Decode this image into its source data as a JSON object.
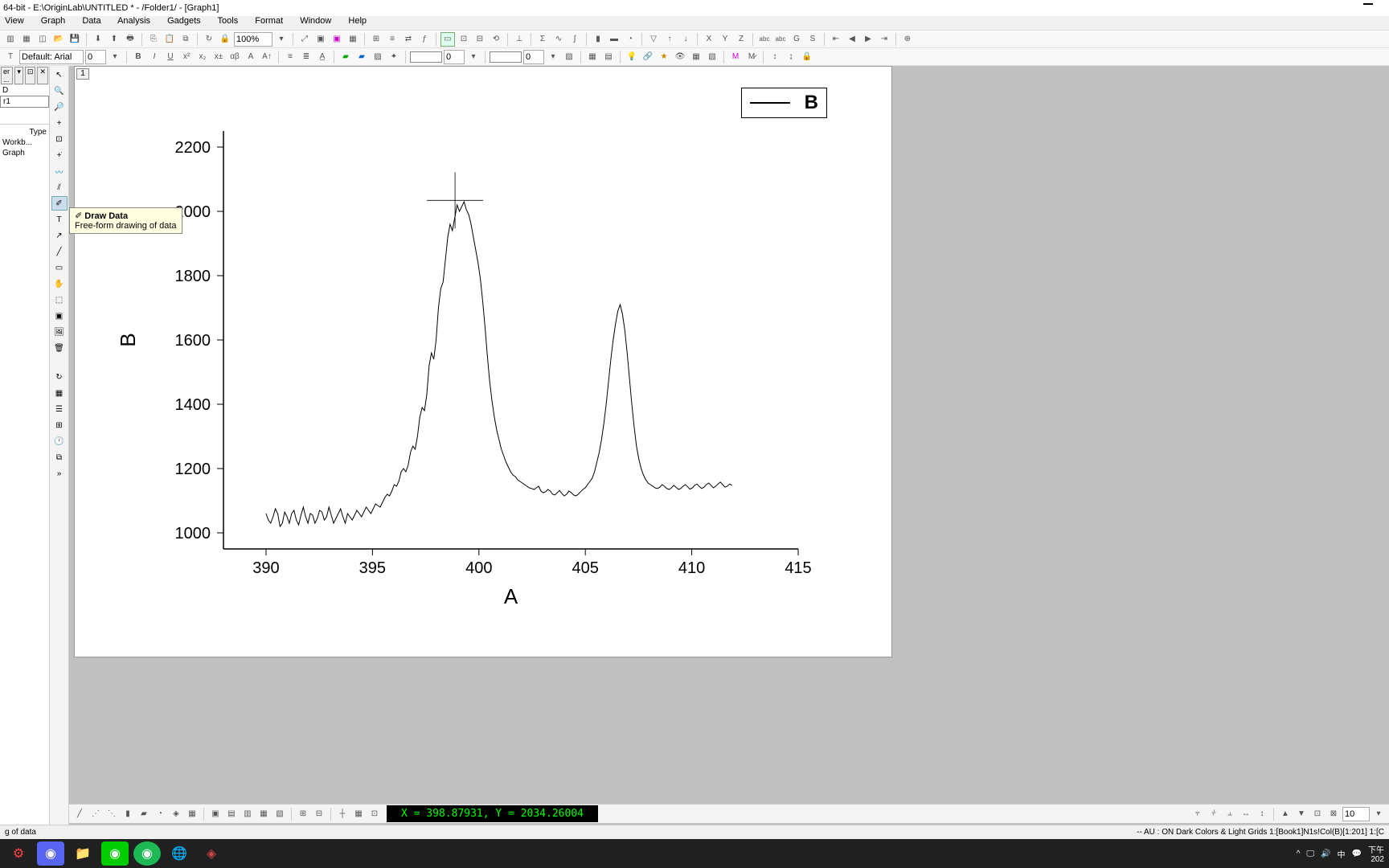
{
  "window": {
    "title": "64-bit - E:\\OriginLab\\UNTITLED * - /Folder1/ - [Graph1]"
  },
  "menu": {
    "items": [
      "View",
      "Graph",
      "Data",
      "Analysis",
      "Gadgets",
      "Tools",
      "Format",
      "Window",
      "Help"
    ]
  },
  "toolbar1": {
    "zoom": "100%"
  },
  "toolbar2": {
    "font_label": "Default: Arial",
    "font_size": "0",
    "num1": "0",
    "num2": "0"
  },
  "project": {
    "col_type": "Type",
    "rows": [
      "D",
      "r1",
      "Workb...",
      "Graph"
    ]
  },
  "tooltip": {
    "title": "Draw Data",
    "desc": "Free-form drawing of data"
  },
  "layer_button": "1",
  "coord_readout": "X = 398.87931, Y = 2034.26004",
  "status_left": "g of data",
  "status_right": "-- AU : ON  Dark Colors & Light Grids  1:[Book1]N1s!Col(B)[1:201]  1:[C",
  "bottom_size": "10",
  "tray": {
    "ime": "中",
    "time_top": "下午",
    "time_bot": "202"
  },
  "chart_data": {
    "type": "line",
    "xlabel": "A",
    "ylabel": "B",
    "xlim": [
      388,
      415
    ],
    "ylim": [
      950,
      2250
    ],
    "xticks": [
      390,
      395,
      400,
      405,
      410,
      415
    ],
    "yticks": [
      1000,
      1200,
      1400,
      1600,
      1800,
      2000,
      2200
    ],
    "legend": "B",
    "cursor": {
      "x": 398.879,
      "y": 2034.26
    },
    "series": [
      {
        "name": "B",
        "x_start": 390.0,
        "x_step": 0.10945,
        "values": [
          1060,
          1040,
          1030,
          1050,
          1075,
          1060,
          1020,
          1030,
          1065,
          1050,
          1030,
          1060,
          1070,
          1040,
          1025,
          1055,
          1080,
          1050,
          1030,
          1060,
          1055,
          1030,
          1045,
          1070,
          1065,
          1040,
          1050,
          1080,
          1055,
          1030,
          1045,
          1060,
          1075,
          1050,
          1030,
          1060,
          1050,
          1040,
          1055,
          1070,
          1060,
          1050,
          1065,
          1080,
          1070,
          1060,
          1075,
          1090,
          1085,
          1080,
          1095,
          1110,
          1120,
          1115,
          1130,
          1150,
          1145,
          1160,
          1190,
          1200,
          1190,
          1210,
          1250,
          1270,
          1260,
          1300,
          1360,
          1390,
          1380,
          1430,
          1520,
          1560,
          1540,
          1600,
          1700,
          1760,
          1780,
          1850,
          1920,
          1960,
          1940,
          1980,
          2020,
          2000,
          2015,
          2030,
          2005,
          1990,
          1960,
          1920,
          1880,
          1840,
          1790,
          1720,
          1640,
          1550,
          1470,
          1410,
          1360,
          1320,
          1290,
          1260,
          1240,
          1220,
          1205,
          1190,
          1180,
          1175,
          1165,
          1160,
          1155,
          1150,
          1145,
          1140,
          1138,
          1135,
          1140,
          1145,
          1130,
          1125,
          1128,
          1135,
          1130,
          1120,
          1118,
          1125,
          1132,
          1122,
          1115,
          1120,
          1130,
          1125,
          1118,
          1115,
          1120,
          1128,
          1135,
          1140,
          1150,
          1160,
          1170,
          1190,
          1220,
          1250,
          1290,
          1340,
          1400,
          1470,
          1540,
          1600,
          1650,
          1690,
          1710,
          1680,
          1630,
          1560,
          1480,
          1400,
          1330,
          1270,
          1230,
          1200,
          1180,
          1165,
          1155,
          1150,
          1145,
          1140,
          1138,
          1142,
          1150,
          1145,
          1138,
          1135,
          1140,
          1148,
          1142,
          1135,
          1138,
          1145,
          1150,
          1143,
          1136,
          1140,
          1148,
          1152,
          1144,
          1138,
          1142,
          1150,
          1155,
          1148,
          1140,
          1145,
          1152,
          1158,
          1150,
          1142,
          1145,
          1152,
          1148
        ]
      }
    ]
  }
}
